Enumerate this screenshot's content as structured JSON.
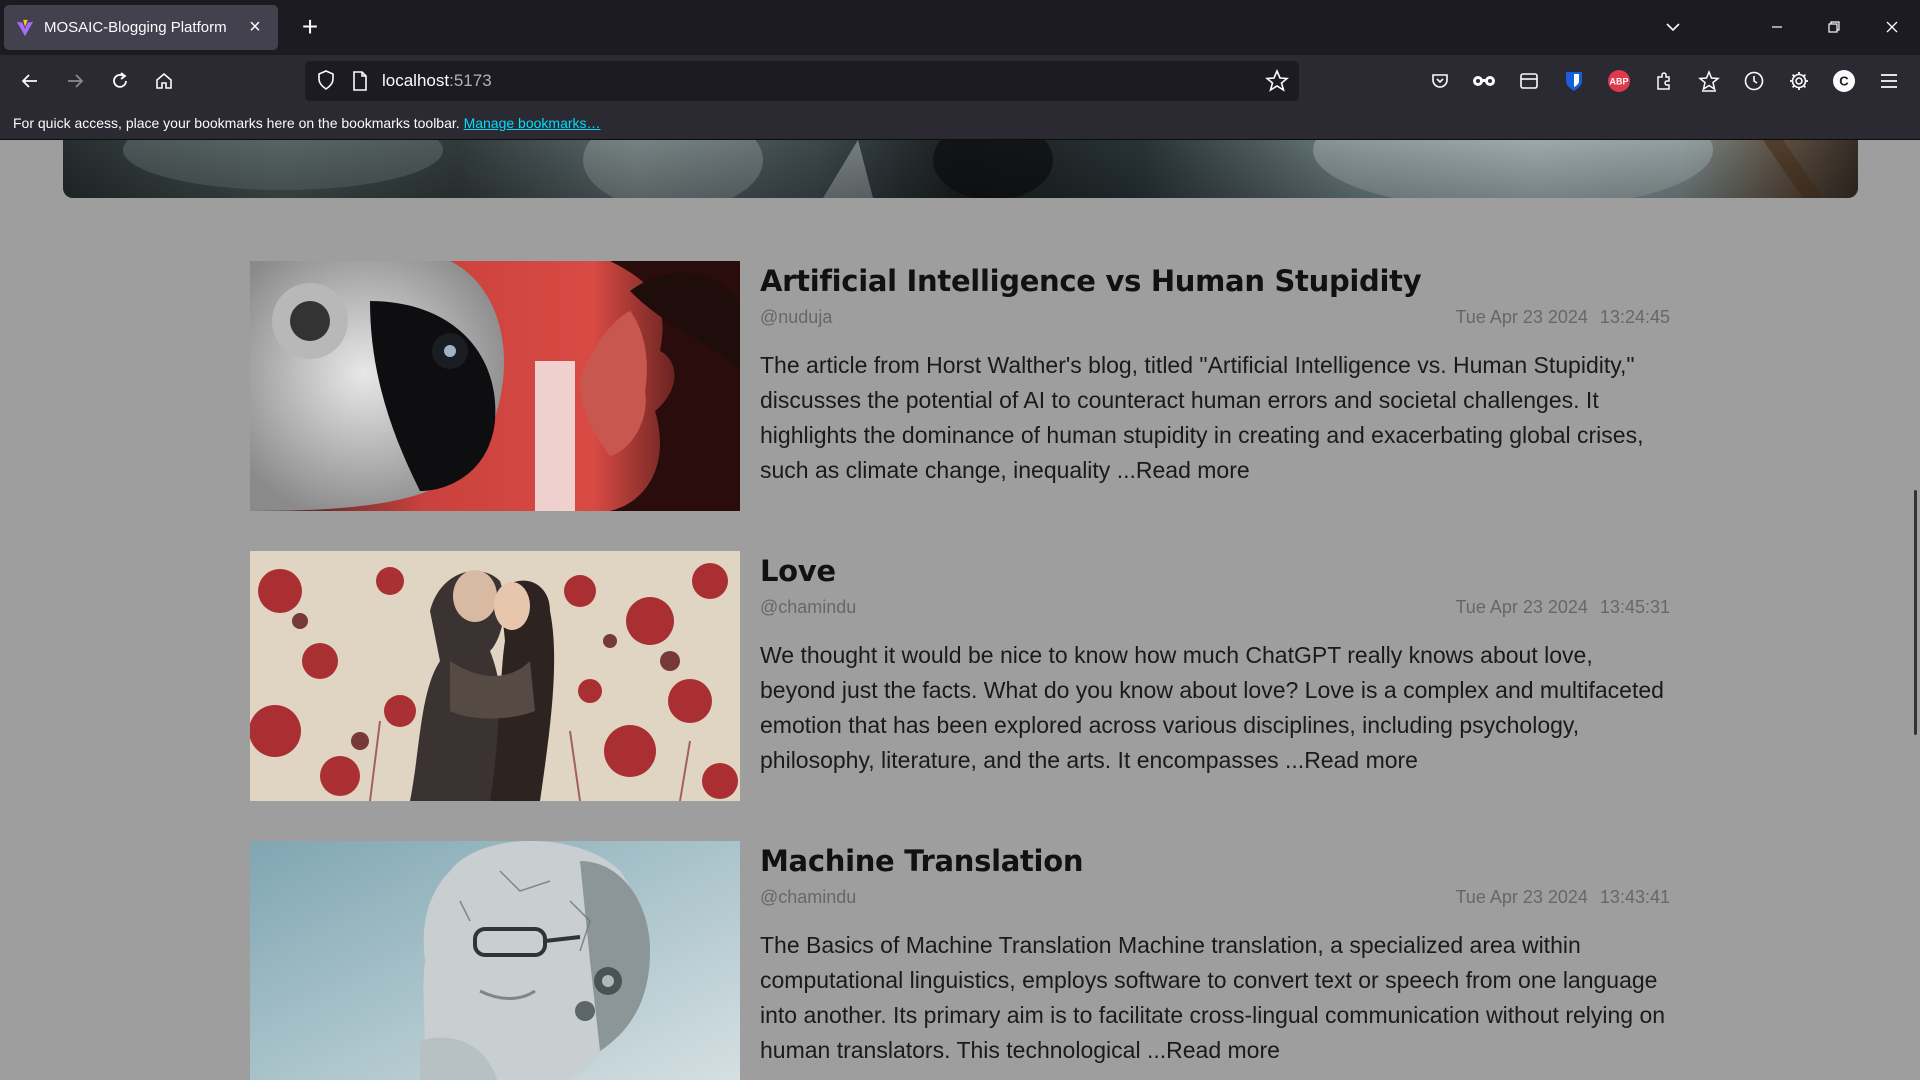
{
  "browser": {
    "tab": {
      "title": "MOSAIC-Blogging Platform"
    },
    "url": {
      "host": "localhost",
      "port": ":5173"
    },
    "bookmarks_bar": {
      "message": "For quick access, place your bookmarks here on the bookmarks toolbar. ",
      "link": "Manage bookmarks…"
    },
    "profile_initial": "C"
  },
  "posts": [
    {
      "title": "Artificial Intelligence vs Human Stupidity",
      "author": "@nuduja",
      "date": "Tue Apr 23 2024",
      "time": "13:24:45",
      "excerpt": "The article from Horst Walther's blog, titled \"Artificial Intelligence vs. Human Stupidity,\" discusses the potential of AI to counteract human errors and societal challenges. It highlights the dominance of human stupidity in creating and exacerbating global crises, such as climate change, inequality ",
      "read_more": "...Read more"
    },
    {
      "title": "Love",
      "author": "@chamindu",
      "date": "Tue Apr 23 2024",
      "time": "13:45:31",
      "excerpt": "We thought it would be nice to know how much ChatGPT really knows about love, beyond just the facts. What do you know about love? Love is a complex and multifaceted emotion that has been explored across various disciplines, including psychology, philosophy, literature, and the arts. It encompasses ",
      "read_more": "...Read more"
    },
    {
      "title": "Machine Translation",
      "author": "@chamindu",
      "date": "Tue Apr 23 2024",
      "time": "13:43:41",
      "excerpt": "The Basics of Machine Translation Machine translation, a specialized area within computational linguistics, employs software to convert text or speech from one language into another. Its primary aim is to facilitate cross-lingual communication without relying on human translators. This technological ",
      "read_more": "...Read more"
    }
  ],
  "icons": {
    "back": "back-arrow-icon",
    "forward": "forward-arrow-icon",
    "reload": "reload-icon",
    "home": "home-icon",
    "pocket": "pocket-icon",
    "reader": "reader-glasses-icon",
    "sidebar": "sidebar-icon",
    "bitwarden": "bitwarden-shield-icon",
    "adblock": "adblock-plus-icon",
    "extensions": "extensions-puzzle-icon",
    "bookmarks": "bookmarks-star-icon",
    "history": "history-clock-icon",
    "settings": "settings-gear-icon",
    "menu": "hamburger-menu-icon"
  },
  "colors": {
    "page_bg": "#9e9e9e",
    "link": "#00ddff",
    "chrome_dark": "#1c1b22",
    "chrome": "#2b2a33"
  }
}
